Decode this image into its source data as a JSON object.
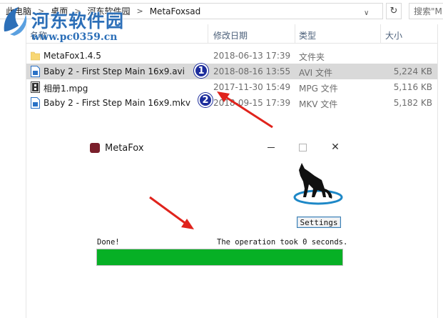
{
  "explorer": {
    "breadcrumb": [
      "此电脑",
      "桌面",
      "河东软件园",
      "MetaFoxsad"
    ],
    "search_placeholder": "搜索\"M",
    "columns": {
      "name": "名称",
      "date": "修改日期",
      "type": "类型",
      "size": "大小"
    },
    "files": [
      {
        "name": "MetaFox1.4.5",
        "date": "2018-06-13 17:39",
        "type": "文件夹",
        "size": "",
        "icon": "folder-icon",
        "selected": false
      },
      {
        "name": "Baby 2 - First Step Main 16x9.avi",
        "date": "2018-08-16 13:55",
        "type": "AVI 文件",
        "size": "5,224 KB",
        "icon": "video-file-icon",
        "selected": true
      },
      {
        "name": "相册1.mpg",
        "date": "2017-11-30 15:49",
        "type": "MPG 文件",
        "size": "5,116 KB",
        "icon": "film-file-icon",
        "selected": false
      },
      {
        "name": "Baby 2 - First Step Main 16x9.mkv",
        "date": "2018-09-15 17:39",
        "type": "MKV 文件",
        "size": "5,182 KB",
        "icon": "video-file-icon",
        "selected": false
      }
    ]
  },
  "watermark": {
    "title": "河东软件园",
    "url": "www.pc0359.cn"
  },
  "markers": [
    "1",
    "2"
  ],
  "metafox": {
    "title": "MetaFox",
    "settings_label": "Settings",
    "status_left": "Done!",
    "status_right": "The operation took 0 seconds.",
    "progress": 1.0
  },
  "colors": {
    "accent": "#06b025",
    "marker": "#1d2d9c",
    "arrow": "#e0231c",
    "watermark": "#2c6fb8",
    "selection": "#d9d9d9"
  }
}
